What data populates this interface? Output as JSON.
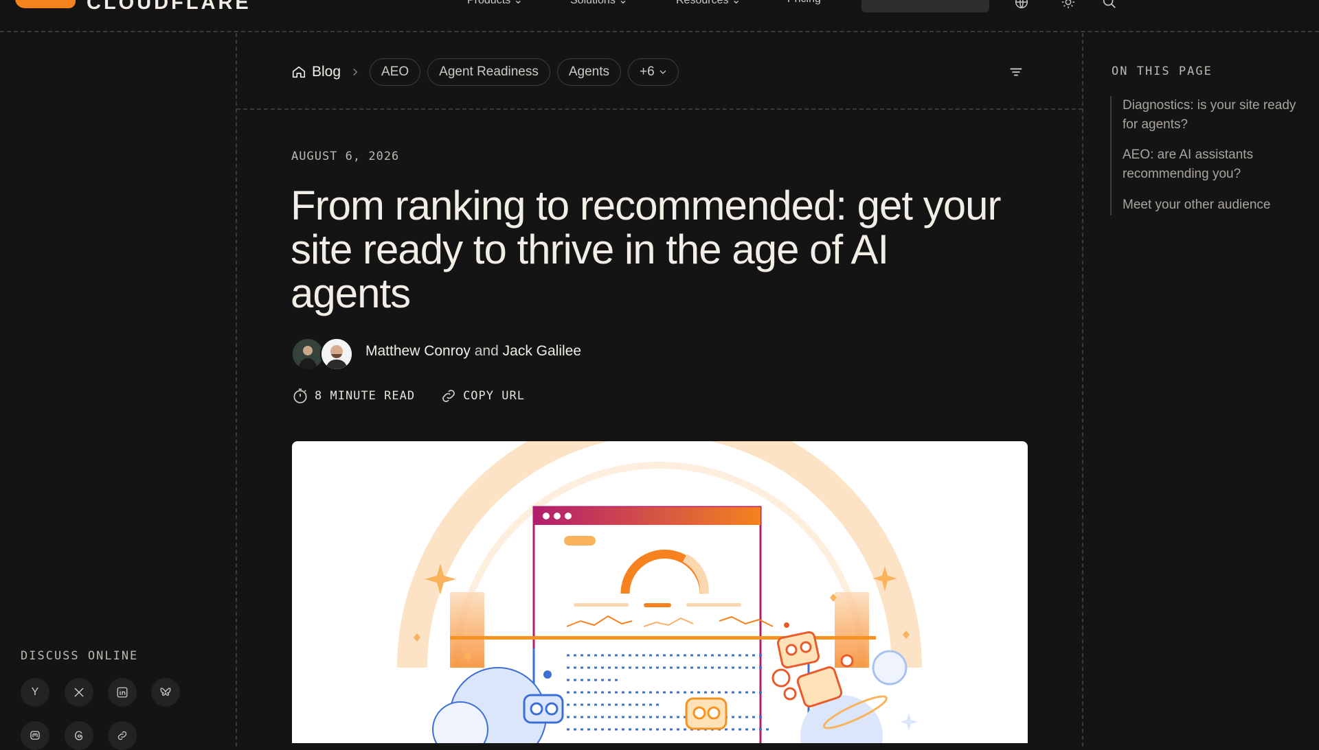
{
  "brand": {
    "name": "CLOUDFLARE",
    "accent": "#f6821f"
  },
  "nav": {
    "items": [
      {
        "label": "Products",
        "icon": "chevron-down-icon"
      },
      {
        "label": "Solutions",
        "icon": "chevron-down-icon"
      },
      {
        "label": "Resources",
        "icon": "chevron-down-icon"
      },
      {
        "label": "Pricing"
      }
    ],
    "icons": [
      "globe-icon",
      "sun-icon",
      "search-icon"
    ]
  },
  "breadcrumb": {
    "blog": "Blog",
    "tags": [
      "AEO",
      "Agent Readiness",
      "Agents"
    ],
    "more": "+6"
  },
  "post": {
    "date": "AUGUST 6, 2026",
    "title": "From ranking to recommended: get your site ready to thrive in the age of AI agents",
    "authors": [
      "Matthew Conroy",
      "Jack Galilee"
    ],
    "authors_joiner": "and",
    "read_time": "8 MINUTE READ",
    "copy_url": "COPY URL"
  },
  "toc": {
    "heading": "ON THIS PAGE",
    "items": [
      "Diagnostics: is your site ready for agents?",
      "AEO: are AI assistants recommending you?",
      "Meet your other audience"
    ]
  },
  "discuss": {
    "heading": "DISCUSS ONLINE",
    "items": [
      {
        "label": "Y",
        "icon": "hacker-news-icon"
      },
      {
        "icon": "x-icon"
      },
      {
        "icon": "linkedin-icon"
      },
      {
        "icon": "bluesky-icon"
      },
      {
        "icon": "mastodon-icon"
      },
      {
        "icon": "threads-icon"
      },
      {
        "icon": "link-icon"
      }
    ]
  }
}
